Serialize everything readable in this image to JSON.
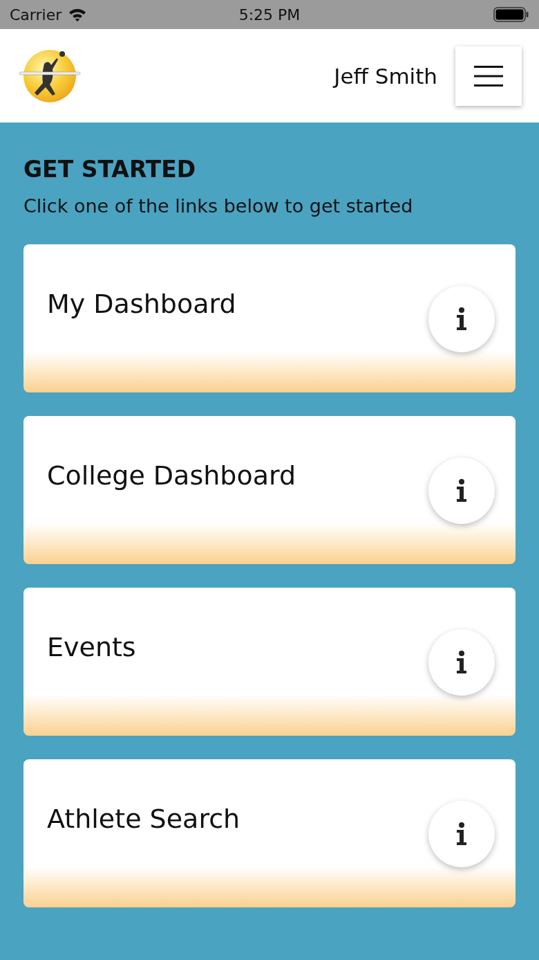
{
  "status_bar": {
    "carrier": "Carrier",
    "time": "5:25 PM"
  },
  "header": {
    "user_name": "Jeff Smith"
  },
  "intro": {
    "title": "GET STARTED",
    "subtitle": "Click one of the links below to get started"
  },
  "cards": [
    {
      "title": "My Dashboard"
    },
    {
      "title": "College Dashboard"
    },
    {
      "title": "Events"
    },
    {
      "title": "Athlete Search"
    }
  ]
}
